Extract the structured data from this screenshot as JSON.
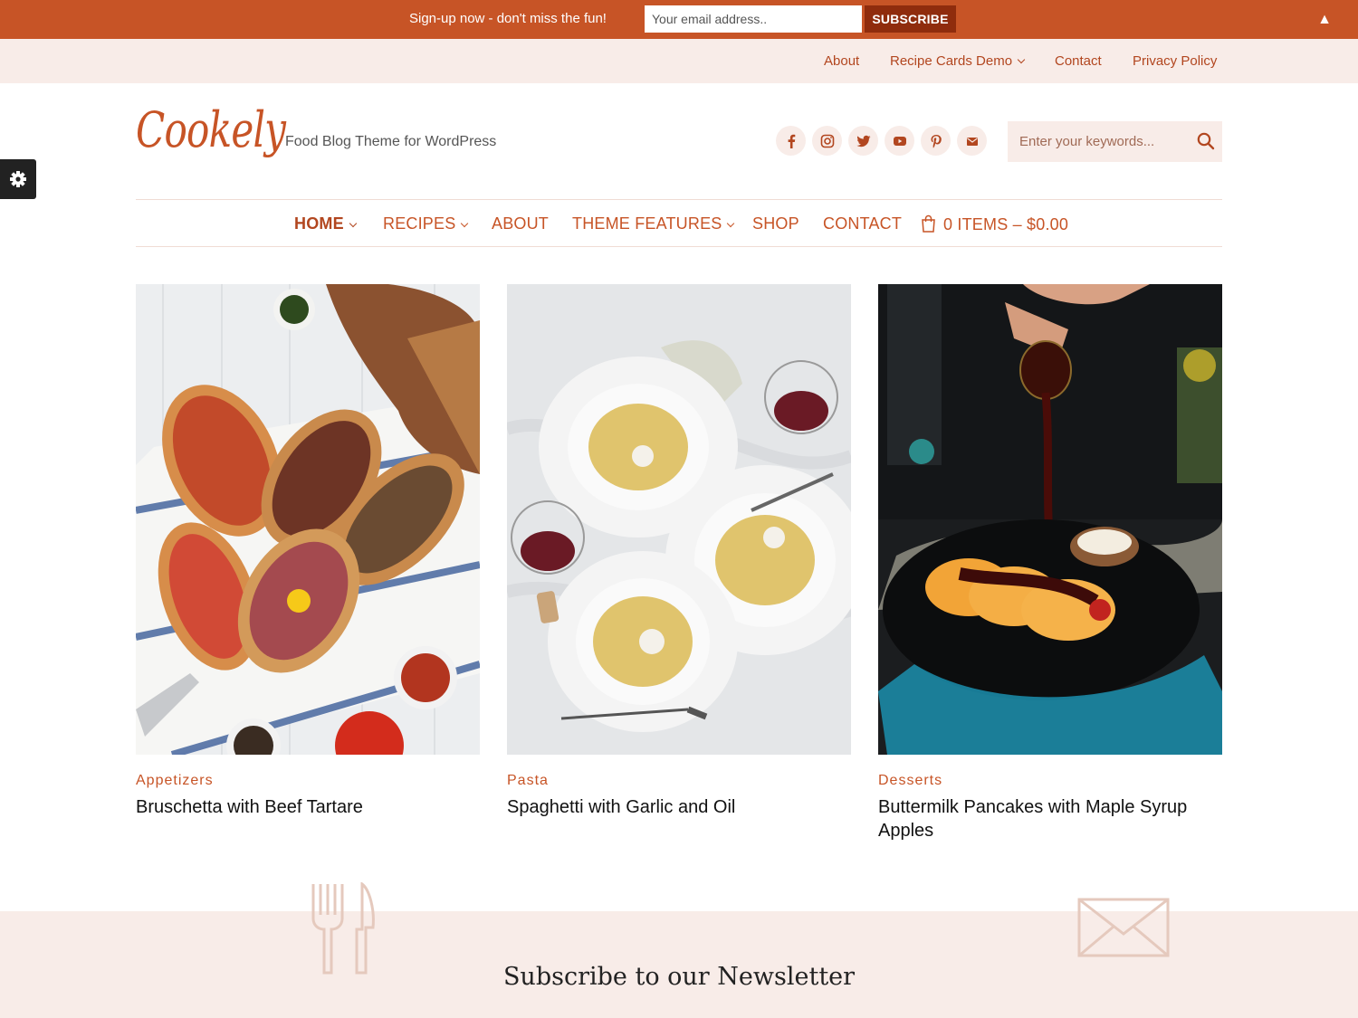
{
  "signup": {
    "text": "Sign-up now - don't miss the fun!",
    "email_placeholder": "Your email address..",
    "subscribe_label": "SUBSCRIBE",
    "collapse_glyph": "▲"
  },
  "top_nav": {
    "items": [
      "About",
      "Recipe Cards Demo",
      "Contact",
      "Privacy Policy"
    ]
  },
  "header": {
    "logo": "Cookely",
    "tagline": "Food Blog Theme for WordPress",
    "social_icons": [
      "facebook-icon",
      "instagram-icon",
      "twitter-icon",
      "youtube-icon",
      "pinterest-icon",
      "email-icon"
    ],
    "search_placeholder": "Enter your keywords..."
  },
  "main_nav": {
    "items": [
      "HOME",
      "RECIPES",
      "ABOUT",
      "THEME FEATURES",
      "SHOP",
      "CONTACT"
    ],
    "cart": "0 ITEMS – $0.00"
  },
  "posts": [
    {
      "category": "Appetizers",
      "title": "Bruschetta with Beef Tartare"
    },
    {
      "category": "Pasta",
      "title": "Spaghetti with Garlic and Oil"
    },
    {
      "category": "Desserts",
      "title": "Buttermilk Pancakes with Maple Syrup Apples"
    }
  ],
  "newsletter": {
    "title": "Subscribe to our Newsletter"
  },
  "colors": {
    "accent": "#c75426",
    "accent_dark": "#8f2c0d",
    "light_bg": "#f8ece8"
  }
}
